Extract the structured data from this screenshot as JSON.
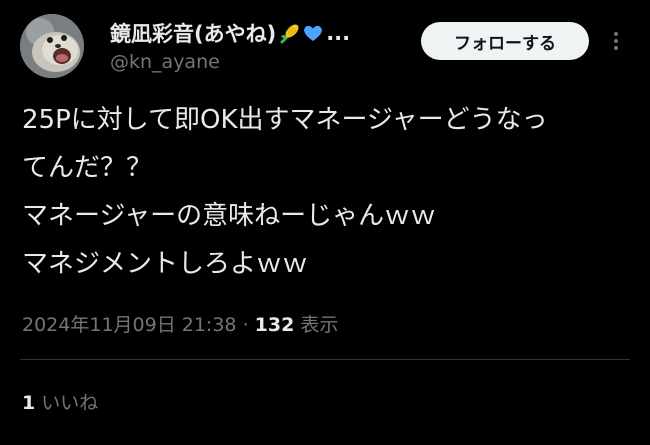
{
  "author": {
    "display_name": "鏡凪彩音(あやね)",
    "name_emojis": [
      "corn-emoji",
      "blue-heart-emoji"
    ],
    "name_truncation": "...",
    "handle": "@kn_ayane",
    "avatar_icon": "seal-avatar"
  },
  "actions": {
    "follow_label": "フォローする",
    "more_icon": "more-vertical-icon"
  },
  "tweet": {
    "lines": [
      "25Pに対して即OK出すマネージャーどうなっ",
      "てんだ？？",
      "マネージャーの意味ねーじゃんｗｗ",
      "マネジメントしろよｗｗ"
    ]
  },
  "meta": {
    "timestamp": "2024年11月09日 21:38",
    "separator": "·",
    "views_count": "132",
    "views_label": "表示"
  },
  "engagement": {
    "likes_count": "1",
    "likes_label": "いいね"
  },
  "colors": {
    "background": "#000000",
    "primary_text": "#e7e9ea",
    "secondary_text": "#71767b",
    "follow_button_bg": "#eff3f4",
    "follow_button_text": "#0f1419",
    "divider": "#2f3336"
  }
}
